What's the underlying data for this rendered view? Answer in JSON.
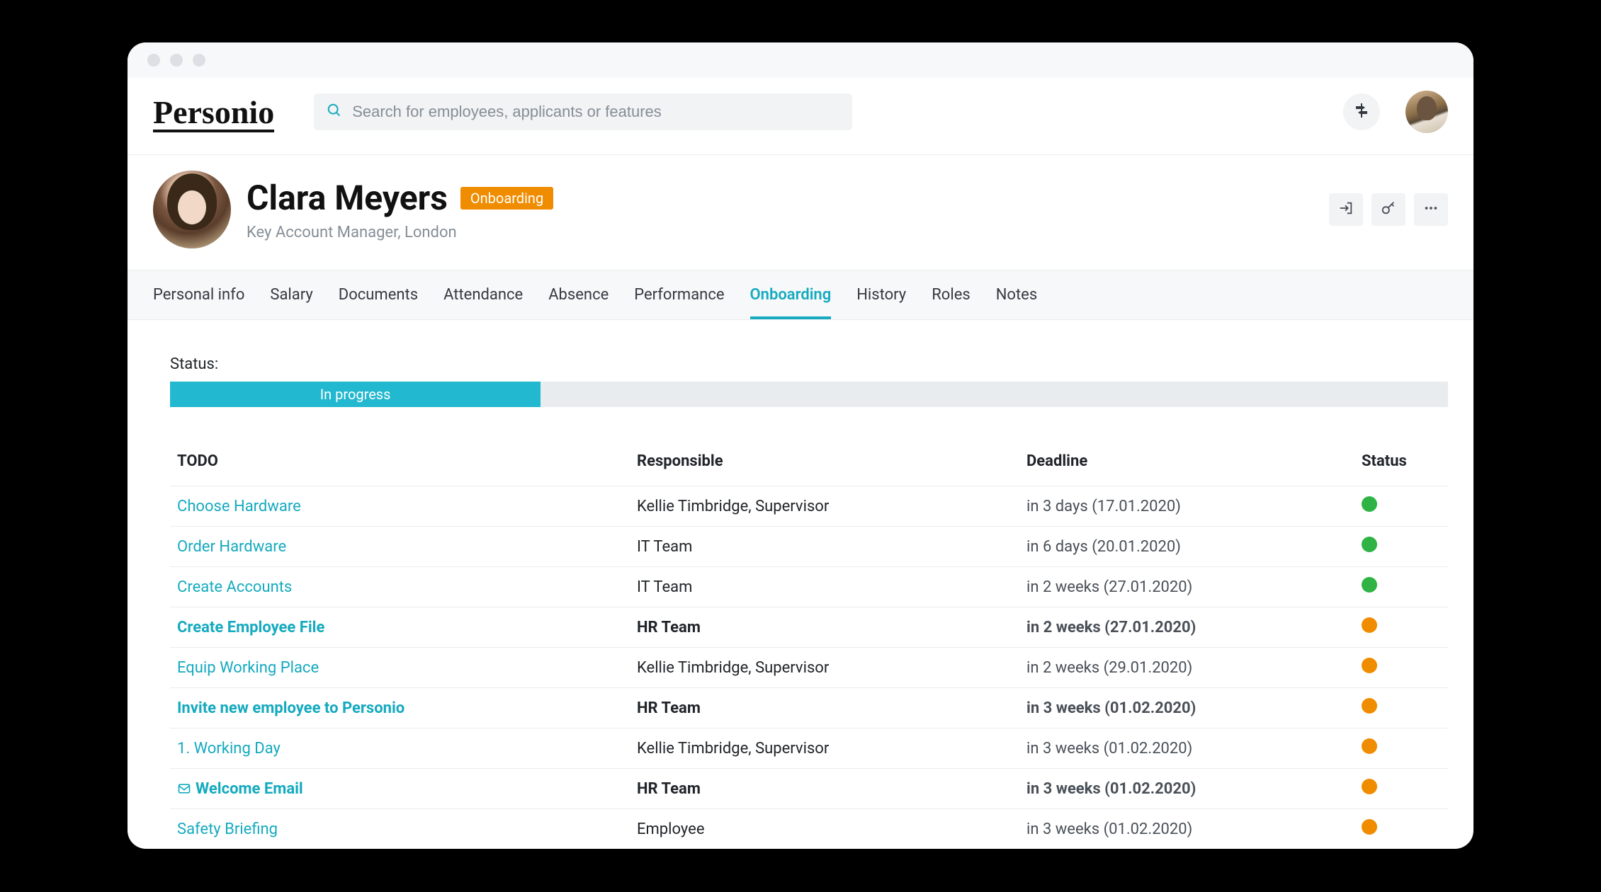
{
  "topbar": {
    "logo": "Personio",
    "search_placeholder": "Search for employees, applicants or features"
  },
  "profile": {
    "name": "Clara Meyers",
    "badge": "Onboarding",
    "subtitle": "Key Account Manager, London"
  },
  "tabs": [
    {
      "label": "Personal info",
      "active": false
    },
    {
      "label": "Salary",
      "active": false
    },
    {
      "label": "Documents",
      "active": false
    },
    {
      "label": "Attendance",
      "active": false
    },
    {
      "label": "Absence",
      "active": false
    },
    {
      "label": "Performance",
      "active": false
    },
    {
      "label": "Onboarding",
      "active": true
    },
    {
      "label": "History",
      "active": false
    },
    {
      "label": "Roles",
      "active": false
    },
    {
      "label": "Notes",
      "active": false
    }
  ],
  "status": {
    "label": "Status:",
    "progress_text": "In progress",
    "progress_percent": 29
  },
  "table": {
    "headers": {
      "todo": "TODO",
      "responsible": "Responsible",
      "deadline": "Deadline",
      "status": "Status"
    },
    "rows": [
      {
        "todo": "Choose Hardware",
        "responsible": "Kellie Timbridge, Supervisor",
        "deadline": "in 3 days (17.01.2020)",
        "status": "green",
        "bold": false,
        "icon": null
      },
      {
        "todo": "Order Hardware",
        "responsible": "IT Team",
        "deadline": "in 6 days (20.01.2020)",
        "status": "green",
        "bold": false,
        "icon": null
      },
      {
        "todo": "Create Accounts",
        "responsible": "IT Team",
        "deadline": "in 2 weeks (27.01.2020)",
        "status": "green",
        "bold": false,
        "icon": null
      },
      {
        "todo": "Create Employee File",
        "responsible": "HR Team",
        "deadline": "in 2 weeks (27.01.2020)",
        "status": "orange",
        "bold": true,
        "icon": null
      },
      {
        "todo": "Equip Working Place",
        "responsible": "Kellie Timbridge, Supervisor",
        "deadline": "in 2 weeks (29.01.2020)",
        "status": "orange",
        "bold": false,
        "icon": null
      },
      {
        "todo": "Invite new employee to Personio",
        "responsible": "HR Team",
        "deadline": "in 3 weeks (01.02.2020)",
        "status": "orange",
        "bold": true,
        "icon": null
      },
      {
        "todo": "1. Working Day",
        "responsible": "Kellie Timbridge, Supervisor",
        "deadline": "in 3 weeks (01.02.2020)",
        "status": "orange",
        "bold": false,
        "icon": null
      },
      {
        "todo": "Welcome Email",
        "responsible": "HR Team",
        "deadline": "in 3 weeks (01.02.2020)",
        "status": "orange",
        "bold": true,
        "icon": "mail"
      },
      {
        "todo": "Safety Briefing",
        "responsible": "Employee",
        "deadline": "in 3 weeks (01.02.2020)",
        "status": "orange",
        "bold": false,
        "icon": null
      }
    ]
  }
}
